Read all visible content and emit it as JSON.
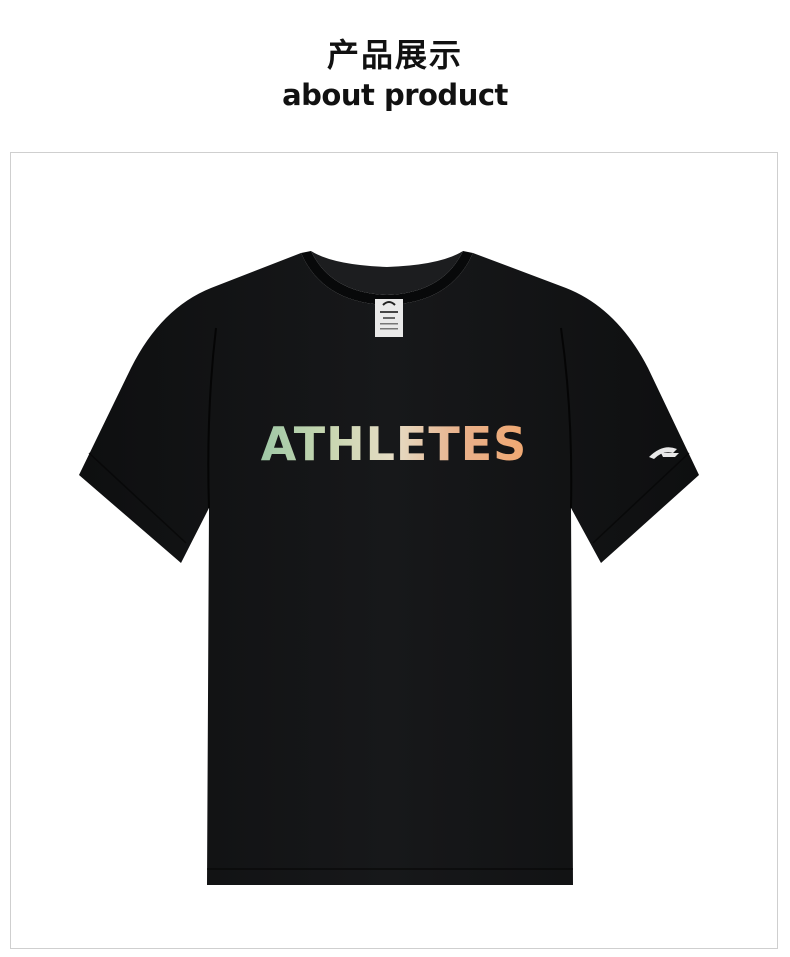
{
  "header": {
    "title_cn": "产品展示",
    "title_en": "about product"
  },
  "product": {
    "print_text": "ATHLETES",
    "shirt_color": "#111213",
    "brand": "ANTA"
  }
}
